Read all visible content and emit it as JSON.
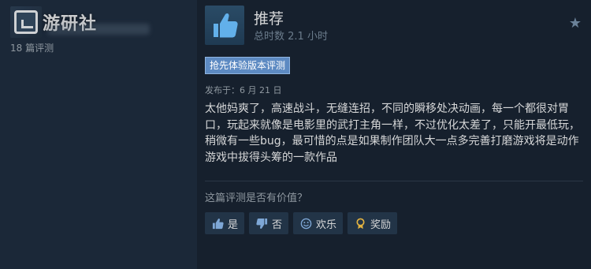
{
  "user": {
    "watermark": "游研社",
    "review_count": "18 篇评测"
  },
  "review": {
    "recommendation": "推荐",
    "hours": "总时数 2.1 小时",
    "badge": "抢先体验版本评测",
    "posted": "发布于：6 月 21 日",
    "body": "太他妈爽了，高速战斗，无缝连招，不同的瞬移处决动画，每一个都很对胃口，玩起来就像是电影里的武打主角一样，不过优化太差了，只能开最低玩，稍微有一些bug，最可惜的点是如果制作团队大一点多完善打磨游戏将是动作游戏中拔得头筹的一款作品",
    "helpful_question": "这篇评测是否有价值？",
    "buttons": {
      "yes": "是",
      "no": "否",
      "funny": "欢乐",
      "award": "奖励"
    }
  },
  "colors": {
    "background_left": "#1b2838",
    "background_right": "#16202d",
    "badge": "#5d8ac2",
    "thumb_up": "#62b0ea"
  },
  "icons": [
    "thumbs-up-icon",
    "star-icon",
    "thumbs-down-icon",
    "smiley-icon",
    "award-icon"
  ]
}
